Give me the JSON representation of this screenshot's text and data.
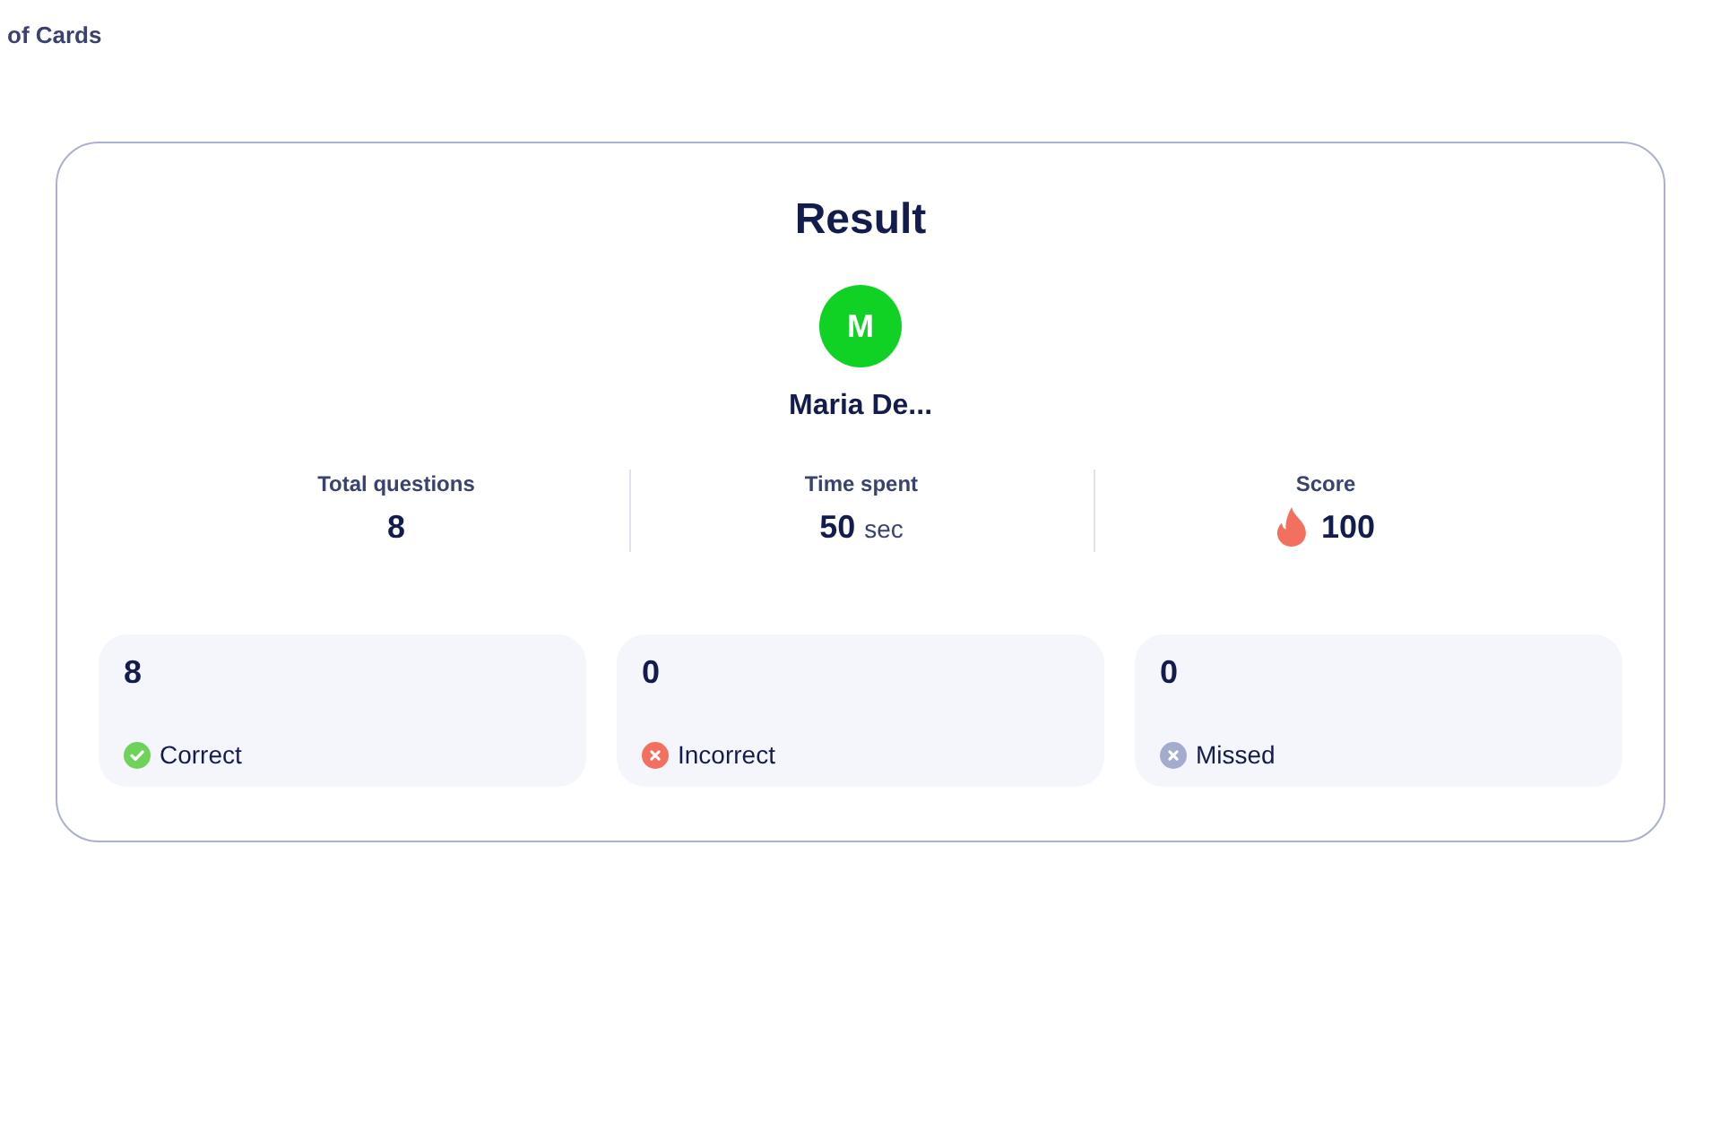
{
  "header": {
    "title": "of Cards"
  },
  "result": {
    "title": "Result",
    "user": {
      "initial": "M",
      "name": "Maria De..."
    },
    "stats": [
      {
        "kind": "plain",
        "label": "Total questions",
        "value": "8"
      },
      {
        "kind": "plain",
        "label": "Time spent",
        "value": "50",
        "unit": "sec"
      },
      {
        "kind": "score",
        "label": "Score",
        "value": "100"
      }
    ],
    "tallies": [
      {
        "kind": "check",
        "count": "8",
        "label": "Correct",
        "color": "#6fd35b"
      },
      {
        "kind": "cross",
        "count": "0",
        "label": "Incorrect",
        "color": "#f4705e"
      },
      {
        "kind": "cross",
        "count": "0",
        "label": "Missed",
        "color": "#a4accd"
      }
    ]
  }
}
